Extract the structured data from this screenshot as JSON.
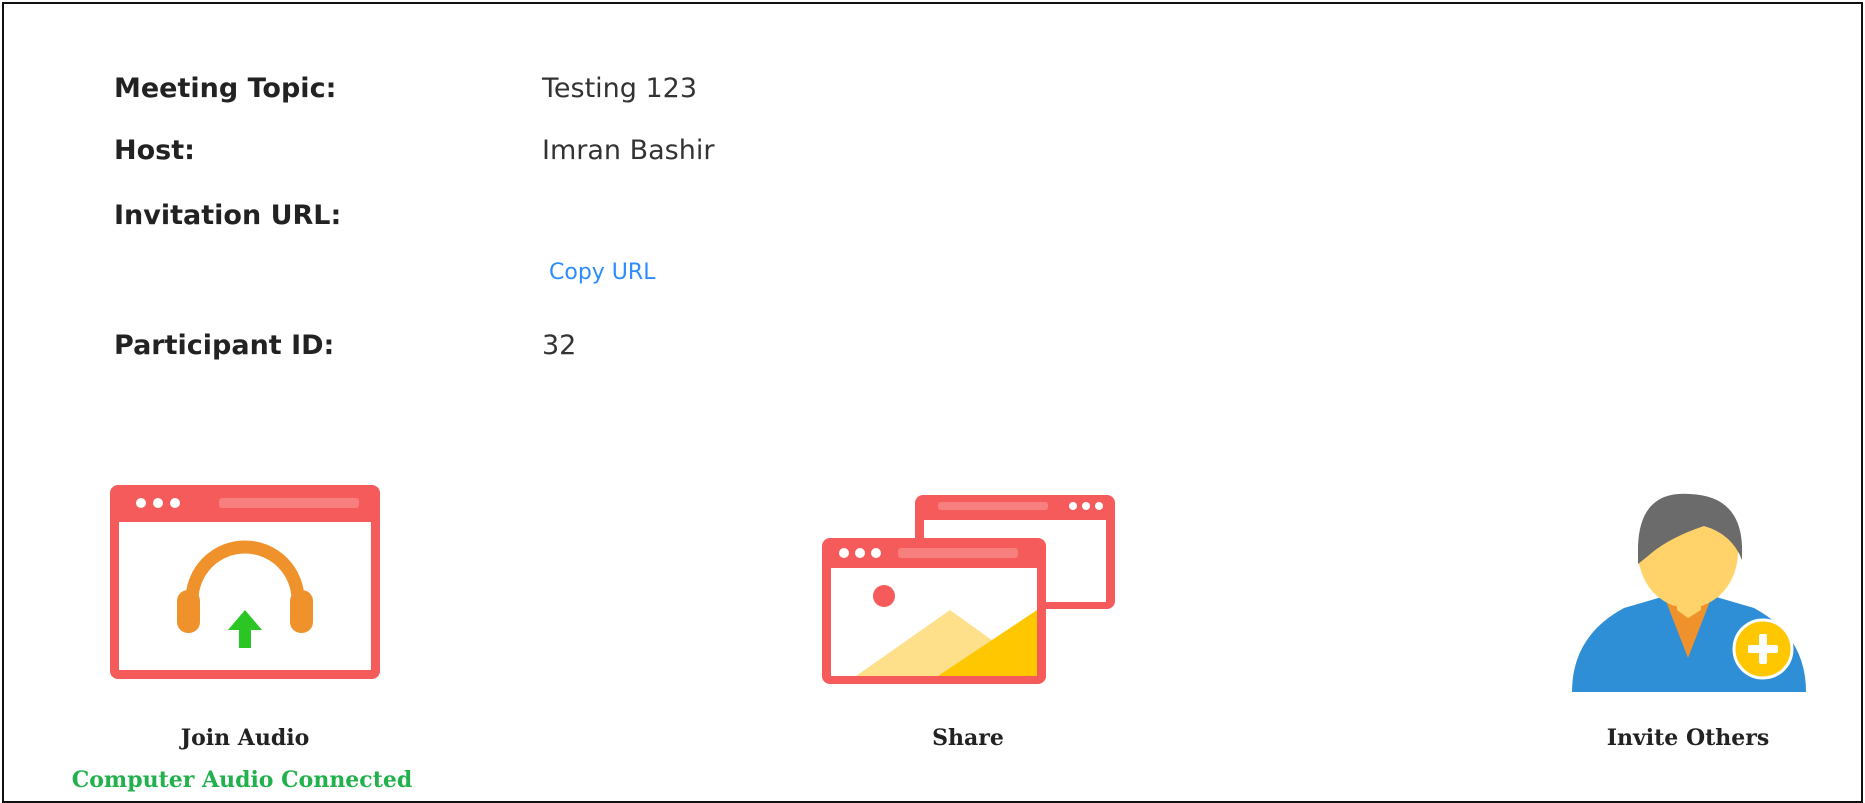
{
  "meeting_info": {
    "topic_label": "Meeting Topic:",
    "topic_value": "Testing 123",
    "host_label": "Host:",
    "host_value": "Imran Bashir",
    "url_label": "Invitation URL:",
    "copy_url_label": "Copy URL",
    "participant_label": "Participant ID:",
    "participant_value": "32"
  },
  "actions": {
    "join_audio_label": "Join Audio",
    "join_audio_status": "Computer Audio Connected",
    "share_label": "Share",
    "invite_label": "Invite Others"
  },
  "colors": {
    "window_red": "#f55b5b",
    "headphone_orange": "#f0922c",
    "arrow_green": "#2bc524",
    "link_blue": "#2d8cff",
    "status_green": "#22b14c",
    "mountain_yellow": "#ffc700",
    "person_blue": "#2f8fd6"
  },
  "icons": {
    "join_audio": "audio-window-icon",
    "share": "share-screens-icon",
    "invite": "invite-person-icon"
  }
}
